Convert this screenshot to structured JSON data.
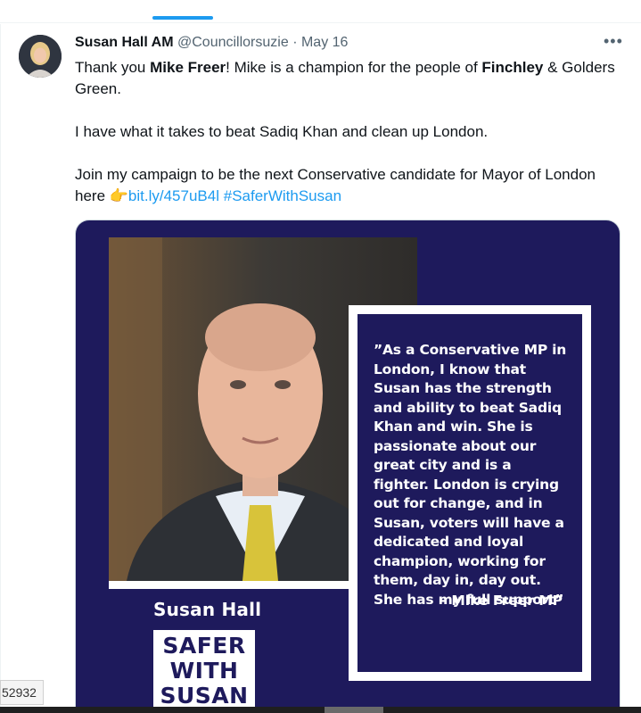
{
  "tabs": {
    "active_indicator_color": "#1d9bf0"
  },
  "tweet": {
    "author_name": "Susan Hall AM",
    "handle": "@Councillorsuzie",
    "separator": "·",
    "date": "May 16",
    "more_label": "•••",
    "paragraph1": {
      "before": "Thank you ",
      "bold1": "Mike Freer",
      "middle": "! Mike is a champion for the people of ",
      "bold2": "Finchley",
      "after": " & Golders Green."
    },
    "paragraph2": "I have what it takes to beat Sadiq Khan and clean up London.",
    "paragraph3": {
      "text": "Join my campaign to be the next Conservative candidate for Mayor of London here ",
      "emoji": "👉",
      "link": "bit.ly/457uB4l",
      "hashtag": "#SaferWithSusan"
    }
  },
  "media": {
    "quote": "”As a Conservative MP in London, I know that Susan has the strength and ability to beat Sadiq Khan and win. She is passionate about our great city and is a fighter. London is crying out for change, and in Susan, voters will have a dedicated and loyal champion, working for them, day in, day out. She has my full support”",
    "attribution": "- Mike Freer MP",
    "candidate_name": "Susan Hall",
    "logo_lines": [
      "SAFER",
      "WITH",
      "SUSAN"
    ],
    "background_color": "#1e1a5c"
  },
  "overlay": {
    "side_tag": "52932"
  },
  "colors": {
    "link": "#1d9bf0",
    "secondary_text": "#536471",
    "primary_text": "#0f1419"
  }
}
